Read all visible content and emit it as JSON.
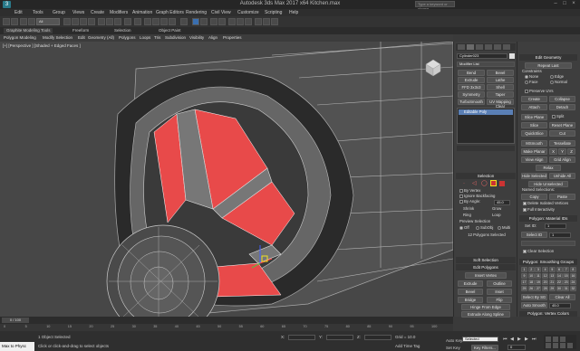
{
  "app": {
    "logo": "3",
    "title": "Autodesk 3ds Max 2017 x64     Kitchen.max",
    "search_placeholder": "Type a keyword or phrase"
  },
  "menu": [
    "Edit",
    "Tools",
    "Group",
    "Views",
    "Create",
    "Modifiers",
    "Animation",
    "Graph Editors",
    "Rendering",
    "Civil View",
    "Customize",
    "Scripting",
    "Help"
  ],
  "toolbar": {
    "selection_filter": "All"
  },
  "ribbon_tabs": [
    "Graphite Modeling Tools",
    "Freeform",
    "Selection",
    "Object Paint"
  ],
  "ribbon_items": [
    "Polygon Modeling",
    "Modify Selection",
    "Edit",
    "Geometry (All)",
    "Polygons",
    "Loops",
    "Tris",
    "Subdivision",
    "Visibility",
    "Align",
    "Properties"
  ],
  "viewport": {
    "label": "[+] [Perspective ] [Shaded + Edged Faces ]"
  },
  "cmd": {
    "object_name": "Cylinder023",
    "modifier_list": "Modifier List",
    "buttons": [
      "Bend",
      "Bevel",
      "Extrude",
      "Lathe",
      "FFD 3x3x3",
      "Shell",
      "Symmetry",
      "Taper",
      "TurboSmooth",
      "UV Mapping Clear"
    ],
    "stack_item": "Editable Poly",
    "selection_header": "Selection",
    "by_vertex": "By Vertex",
    "ignore_backfacing": "Ignore Backfacing",
    "by_angle": "By Angle:",
    "angle_value": "45.0",
    "shrink": "Shrink",
    "grow": "Grow",
    "ring": "Ring",
    "loop": "Loop",
    "preview_selection": "Preview Selection",
    "preview_off": "Off",
    "preview_subobj": "SubObj",
    "preview_multi": "Multi",
    "sel_status": "12 Polygons Selected",
    "soft_selection": "Soft Selection",
    "edit_polygons": "Edit Polygons",
    "insert_vertex": "Insert Vertex",
    "extrude": "Extrude",
    "outline": "Outline",
    "bevel": "Bevel",
    "inset": "Inset",
    "bridge": "Bridge",
    "flip": "Flip",
    "hinge": "Hinge From Edge",
    "extrude_spline": "Extrude Along Spline",
    "edit_triangulation": "Edit Triangulation",
    "retriangulate": "Retriangulate",
    "turn": "Turn"
  },
  "geom": {
    "header": "Edit Geometry",
    "repeat_last": "Repeat Last",
    "constraints": "Constraints",
    "none": "None",
    "edge": "Edge",
    "face": "Face",
    "normal": "Normal",
    "preserve_uvs": "Preserve UVs",
    "create": "Create",
    "collapse": "Collapse",
    "attach": "Attach",
    "detach": "Detach",
    "slice_plane": "Slice Plane",
    "split": "Split",
    "slice": "Slice",
    "reset_plane": "Reset Plane",
    "quickslice": "QuickSlice",
    "cut": "Cut",
    "msmooth": "MSmooth",
    "tessellate": "Tessellate",
    "make_planar": "Make Planar",
    "x": "X",
    "y": "Y",
    "z": "Z",
    "view_align": "View Align",
    "grid_align": "Grid Align",
    "relax": "Relax",
    "hide_selected": "Hide Selected",
    "unhide_all": "Unhide All",
    "hide_unselected": "Hide Unselected",
    "named_selections": "Named Selections:",
    "copy": "Copy",
    "paste": "Paste",
    "delete_isolated": "Delete Isolated Vertices",
    "full_interactivity": "Full Interactivity",
    "mat_header": "Polygon: Material IDs",
    "set_id": "Set ID:",
    "set_id_value": "1",
    "select_id": "Select ID",
    "select_id_value": "1",
    "clear_selection": "Clear Selection",
    "smooth_header": "Polygon: Smoothing Groups",
    "smoothing_numbers": [
      "1",
      "2",
      "3",
      "4",
      "5",
      "6",
      "7",
      "8",
      "9",
      "10",
      "11",
      "12",
      "13",
      "14",
      "15",
      "16",
      "17",
      "18",
      "19",
      "20",
      "21",
      "22",
      "23",
      "24",
      "25",
      "26",
      "27",
      "28",
      "29",
      "30",
      "31",
      "32"
    ],
    "select_by_sg": "Select By SG",
    "clear_all": "Clear All",
    "auto_smooth": "Auto Smooth",
    "auto_smooth_value": "45.0",
    "vc_header": "Polygon: Vertex Colors",
    "color": "Color:"
  },
  "timeline": {
    "frame": "0 / 100",
    "ticks": [
      "0",
      "5",
      "10",
      "15",
      "20",
      "25",
      "30",
      "35",
      "40",
      "45",
      "50",
      "55",
      "60",
      "65",
      "70",
      "75",
      "80",
      "85",
      "90",
      "95",
      "100"
    ]
  },
  "status": {
    "script_listener": "Max to Physc",
    "selected": "1 Object Selected",
    "hint": "Click or click-and-drag to select objects",
    "x_label": "X:",
    "y_label": "Y:",
    "z_label": "Z:",
    "grid": "Grid = 10.0",
    "add_time_tag": "Add Time Tag",
    "auto_key": "Auto Key",
    "selected_dropdown": "Selected",
    "set_key": "Set Key",
    "key_filters": "Key Filters...",
    "frame_value": "0"
  },
  "colors": {
    "accent": "#f0e020",
    "poly_red": "#e84a4a",
    "viewport_bg": "#474747",
    "panel_bg": "#3e3e3e"
  }
}
